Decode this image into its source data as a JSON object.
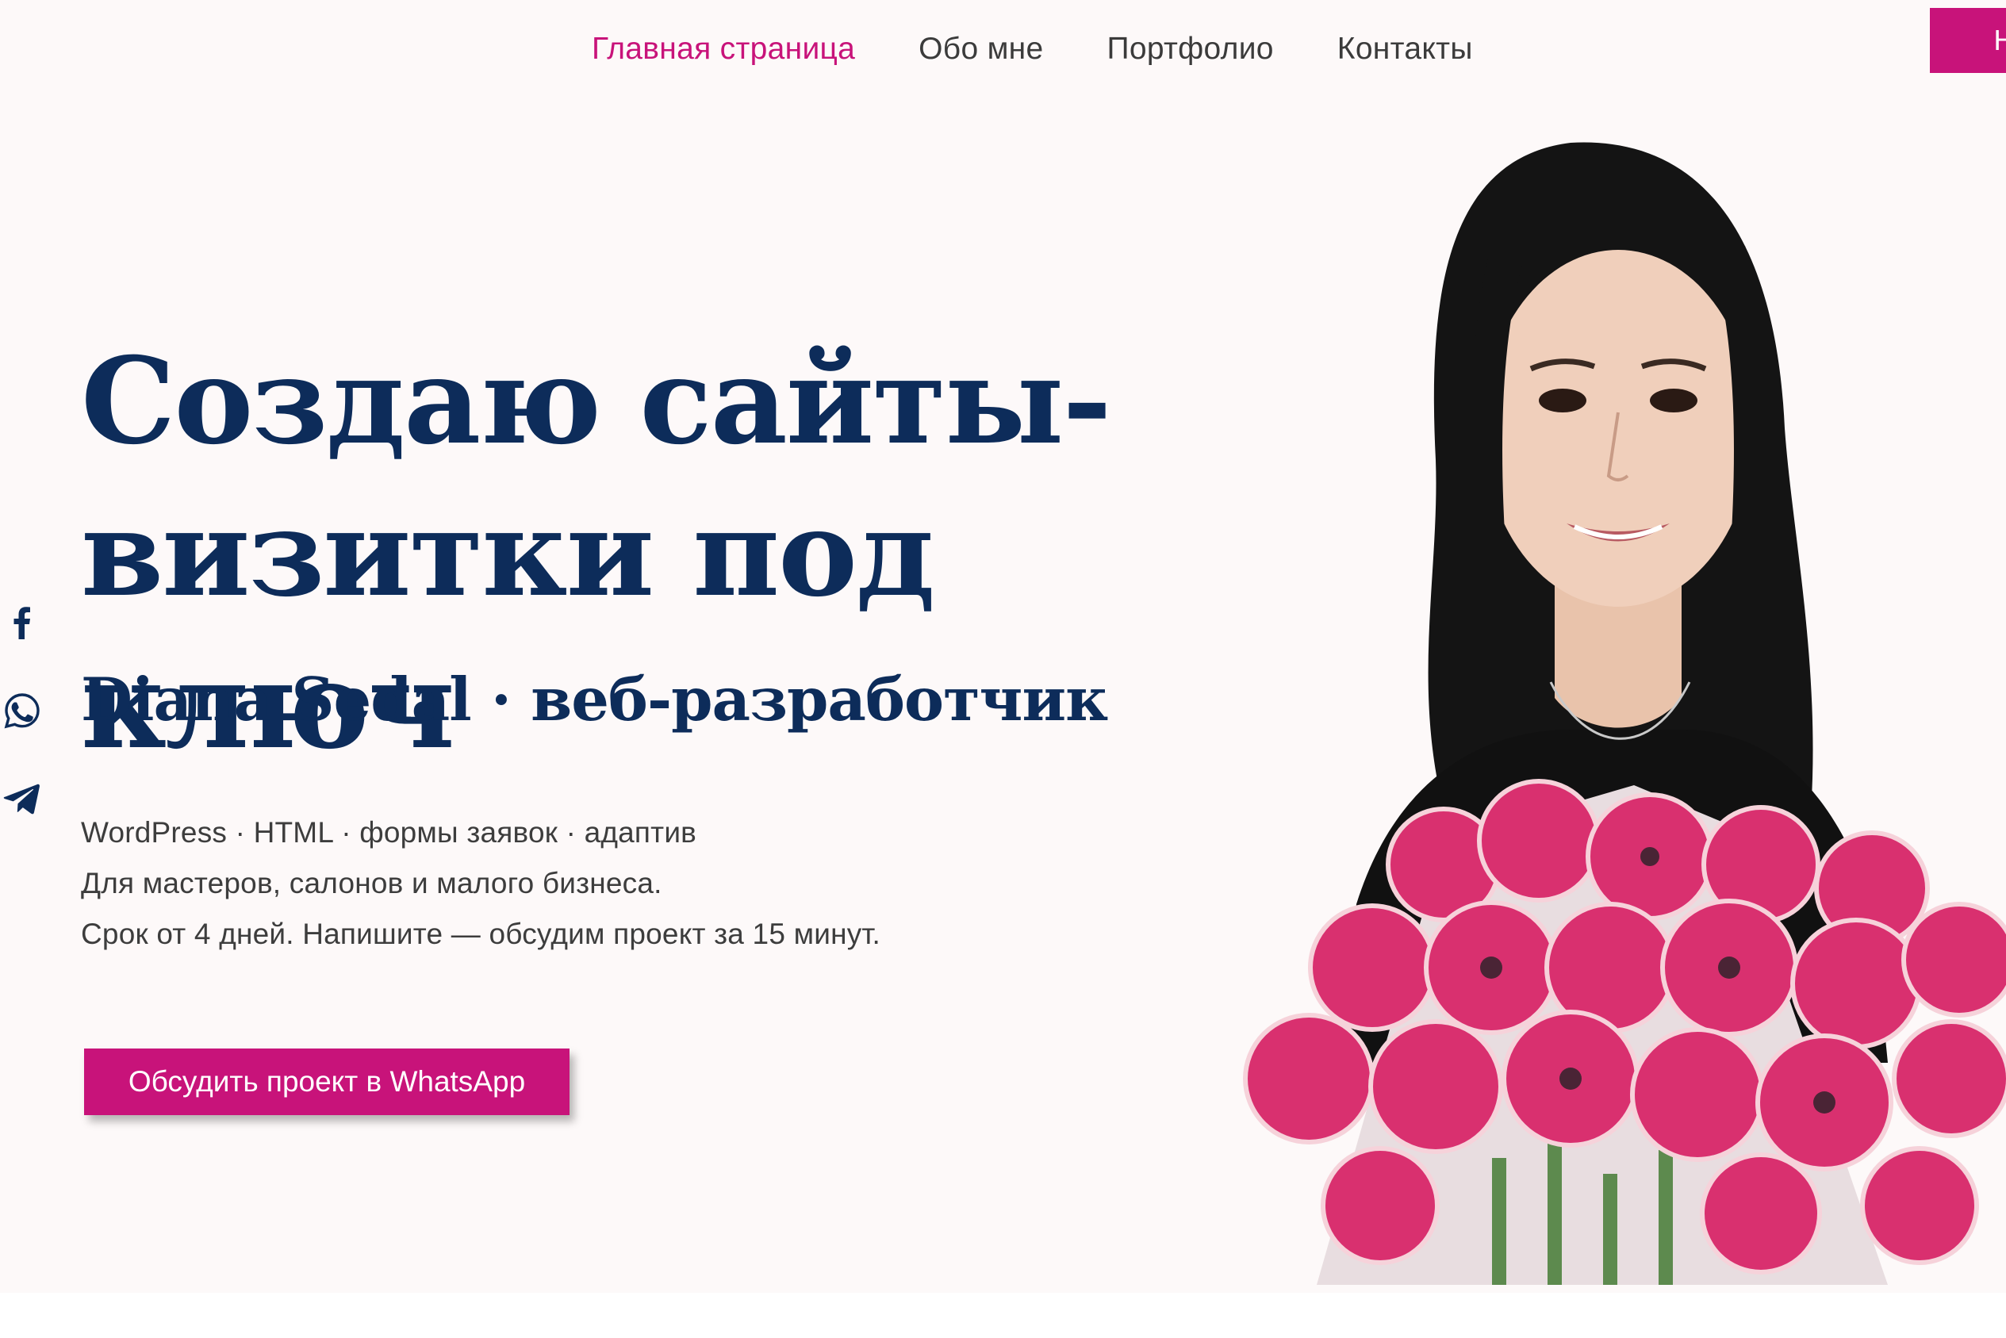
{
  "nav": {
    "items": [
      {
        "label": "Главная страница",
        "active": true
      },
      {
        "label": "Обо мне",
        "active": false
      },
      {
        "label": "Портфолио",
        "active": false
      },
      {
        "label": "Контакты",
        "active": false
      }
    ],
    "cta_label": "На"
  },
  "social": [
    {
      "icon": "facebook-icon"
    },
    {
      "icon": "whatsapp-icon"
    },
    {
      "icon": "telegram-icon"
    }
  ],
  "hero": {
    "title_line1": "Создаю сайты-",
    "title_line2": "визитки под ключ",
    "subtitle": "Diana Sedal · веб-разработчик",
    "lines": [
      "WordPress · HTML · формы заявок · адаптив",
      "Для мастеров, салонов и малого бизнеса.",
      "Срок от 4 дней. Напишите — обсудим проект за 15 минут."
    ],
    "cta_label": "Обсудить проект в WhatsApp"
  },
  "colors": {
    "accent": "#c8137a",
    "heading": "#0d2c5a",
    "background": "#fdf9f9",
    "body_text": "#3d3d3d"
  }
}
